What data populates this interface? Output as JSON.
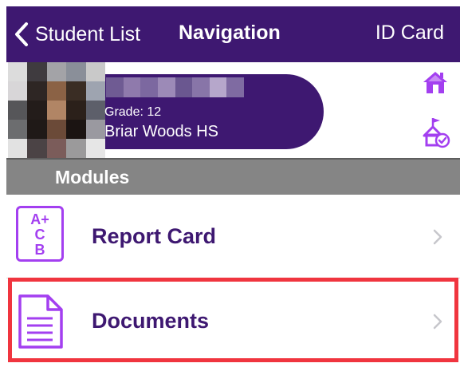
{
  "navbar": {
    "back_label": "Student List",
    "title": "Navigation",
    "right_label": "ID Card"
  },
  "student": {
    "grade": "Grade: 12",
    "school": "Briar Woods HS"
  },
  "modules": {
    "header": "Modules",
    "items": [
      {
        "label": "Report Card",
        "icon": "report-card-icon",
        "grades": [
          "A+",
          "C",
          "B"
        ]
      },
      {
        "label": "Documents",
        "icon": "documents-icon"
      }
    ]
  },
  "colors": {
    "brand_purple": "#3e1871",
    "accent_violet": "#a33ff0",
    "section_gray": "#858585",
    "highlight_red": "#f0353f"
  }
}
